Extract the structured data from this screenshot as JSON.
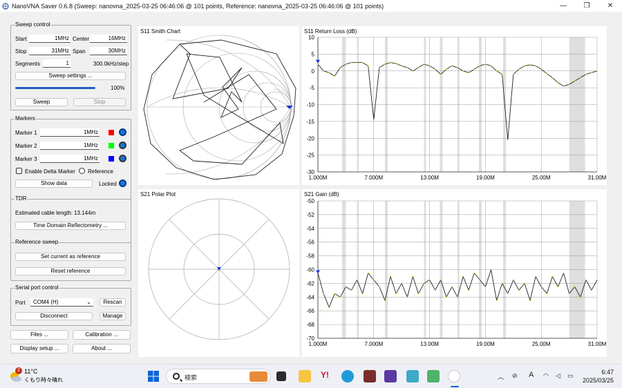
{
  "window": {
    "title": "NanoVNA Saver 0.6.8 (Sweep: nanovna_2025-03-25 06:46:06 @ 101 points, Reference: nanovna_2025-03-25 06:46:06 @ 101 points)",
    "minimize": "—",
    "maximize": "❐",
    "close": "✕"
  },
  "sweep_control": {
    "title": "Sweep control",
    "start_label": "Start",
    "start_value": "1MHz",
    "center_label": "Center",
    "center_value": "16MHz",
    "stop_label": "Stop",
    "stop_value": "31MHz",
    "span_label": "Span",
    "span_value": "30MHz",
    "segments_label": "Segments",
    "segments_value": "1",
    "step_text": "300.0kHz/step",
    "settings_button": "Sweep settings ...",
    "progress": 1.0,
    "progress_text": "100%",
    "sweep_button": "Sweep",
    "stop_button": "Stop"
  },
  "markers": {
    "title": "Markers",
    "items": [
      {
        "label": "Marker 1",
        "value": "1MHz",
        "color": "#ff0000"
      },
      {
        "label": "Marker 2",
        "value": "1MHz",
        "color": "#00ff00"
      },
      {
        "label": "Marker 3",
        "value": "1MHz",
        "color": "#0000ff"
      }
    ],
    "delta_label": "Enable Delta Marker",
    "reference_label": "Reference",
    "show_data_button": "Show data",
    "locked_label": "Locked"
  },
  "tdr": {
    "title": "TDR",
    "cable_label": "Estimated cable length:",
    "cable_value": "13.144m",
    "tdr_button": "Time Domain Reflectometry ..."
  },
  "reference_sweep": {
    "title": "Reference sweep",
    "set_button": "Set current as reference",
    "reset_button": "Reset reference"
  },
  "serial": {
    "title": "Serial port control",
    "port_label": "Port",
    "port_value": "COM4 (H)",
    "rescan_button": "Rescan",
    "disconnect_button": "Disconnect",
    "manage_button": "Manage"
  },
  "bottom_buttons": {
    "files": "Files ...",
    "calibration": "Calibration ...",
    "display": "Display setup ...",
    "about": "About ..."
  },
  "smith": {
    "title": "S11 Smith Chart"
  },
  "polar": {
    "title": "S21 Polar Plot"
  },
  "chart_data": [
    {
      "type": "line",
      "title": "S11 Return Loss (dB)",
      "ylim": [
        -30,
        10
      ],
      "yticks": [
        "10",
        "5",
        "0",
        "-5",
        "-10",
        "-15",
        "-20",
        "-25",
        "-30"
      ],
      "xticks": [
        "1.000M",
        "7.000M",
        "13.00M",
        "19.00M",
        "25.00M",
        "31.00M"
      ],
      "x": [
        1.0,
        1.6,
        2.2,
        2.8,
        3.4,
        4.0,
        4.6,
        5.2,
        5.8,
        6.4,
        7.0,
        7.6,
        8.2,
        8.8,
        9.4,
        10.0,
        10.6,
        11.2,
        11.8,
        12.4,
        13.0,
        13.6,
        14.2,
        14.8,
        15.4,
        16.0,
        16.6,
        17.2,
        17.8,
        18.4,
        19.0,
        19.6,
        20.2,
        20.8,
        21.4,
        22.0,
        22.6,
        23.2,
        23.8,
        24.4,
        25.0,
        25.6,
        26.2,
        26.8,
        27.4,
        28.0,
        28.6,
        29.2,
        29.8,
        30.4,
        31.0
      ],
      "series": [
        {
          "values": [
            2.0,
            0.0,
            -0.5,
            -1.5,
            1.0,
            2.0,
            2.5,
            2.5,
            2.5,
            1.5,
            -14.5,
            1.0,
            2.0,
            2.5,
            2.2,
            1.5,
            1.0,
            0.0,
            1.0,
            2.0,
            1.5,
            0.5,
            -1.0,
            0.5,
            1.5,
            1.0,
            0.0,
            -0.5,
            0.5,
            1.5,
            2.0,
            1.5,
            0.0,
            -1.0,
            -20.5,
            -1.0,
            0.5,
            1.5,
            1.8,
            1.5,
            0.5,
            -0.8,
            -2.0,
            -3.5,
            -4.5,
            -4.0,
            -3.0,
            -2.0,
            -1.0,
            -0.5,
            0.0
          ]
        }
      ],
      "marker": {
        "x": 1.0,
        "y": 2.5
      },
      "shaded": [
        [
          3.6,
          4.0
        ],
        [
          5.2,
          5.4
        ],
        [
          8.2,
          8.5
        ],
        [
          12.4,
          12.6
        ],
        [
          14.1,
          14.4
        ],
        [
          16.0,
          16.2
        ],
        [
          18.3,
          18.6
        ],
        [
          20.9,
          21.2
        ],
        [
          28.0,
          29.7
        ]
      ]
    },
    {
      "type": "line",
      "title": "S21 Gain (dB)",
      "ylim": [
        -70,
        -50
      ],
      "yticks": [
        "-50",
        "-52",
        "-54",
        "-56",
        "-58",
        "-60",
        "-62",
        "-64",
        "-66",
        "-68",
        "-70"
      ],
      "xticks": [
        "1.000M",
        "7.000M",
        "13.00M",
        "19.00M",
        "25.00M",
        "31.00M"
      ],
      "x": [
        1.0,
        1.6,
        2.2,
        2.8,
        3.4,
        4.0,
        4.6,
        5.2,
        5.8,
        6.4,
        7.0,
        7.6,
        8.2,
        8.8,
        9.4,
        10.0,
        10.6,
        11.2,
        11.8,
        12.4,
        13.0,
        13.6,
        14.2,
        14.8,
        15.4,
        16.0,
        16.6,
        17.2,
        17.8,
        18.4,
        19.0,
        19.6,
        20.2,
        20.8,
        21.4,
        22.0,
        22.6,
        23.2,
        23.8,
        24.4,
        25.0,
        25.6,
        26.2,
        26.8,
        27.4,
        28.0,
        28.6,
        29.2,
        29.8,
        30.4,
        31.0
      ],
      "series": [
        {
          "values": [
            -60.5,
            -63.5,
            -65.5,
            -63.5,
            -64.0,
            -62.5,
            -63.0,
            -61.5,
            -63.5,
            -60.5,
            -61.5,
            -62.5,
            -64.5,
            -61.0,
            -63.5,
            -62.0,
            -64.0,
            -61.0,
            -63.5,
            -62.0,
            -61.5,
            -63.0,
            -61.5,
            -64.0,
            -62.5,
            -64.0,
            -61.0,
            -63.0,
            -60.5,
            -61.5,
            -62.5,
            -60.0,
            -64.5,
            -62.0,
            -63.5,
            -61.5,
            -63.0,
            -62.0,
            -64.5,
            -61.0,
            -62.5,
            -63.5,
            -61.0,
            -62.5,
            -60.5,
            -63.5,
            -62.5,
            -64.0,
            -61.5,
            -63.0,
            -61.5
          ]
        }
      ],
      "marker": {
        "x": 1.0,
        "y": -60.5
      },
      "shaded": [
        [
          3.6,
          4.0
        ],
        [
          5.2,
          5.4
        ],
        [
          8.2,
          8.5
        ],
        [
          12.4,
          12.6
        ],
        [
          14.1,
          14.4
        ],
        [
          16.0,
          16.2
        ],
        [
          18.3,
          18.6
        ],
        [
          20.9,
          21.2
        ],
        [
          28.0,
          29.7
        ]
      ]
    }
  ],
  "taskbar": {
    "weather_temp": "11°C",
    "weather_text": "くもり時々晴れ",
    "weather_badge": "2",
    "search_placeholder": "検索",
    "tray_lang": "A",
    "time": "6:47",
    "date": "2025/03/25"
  }
}
